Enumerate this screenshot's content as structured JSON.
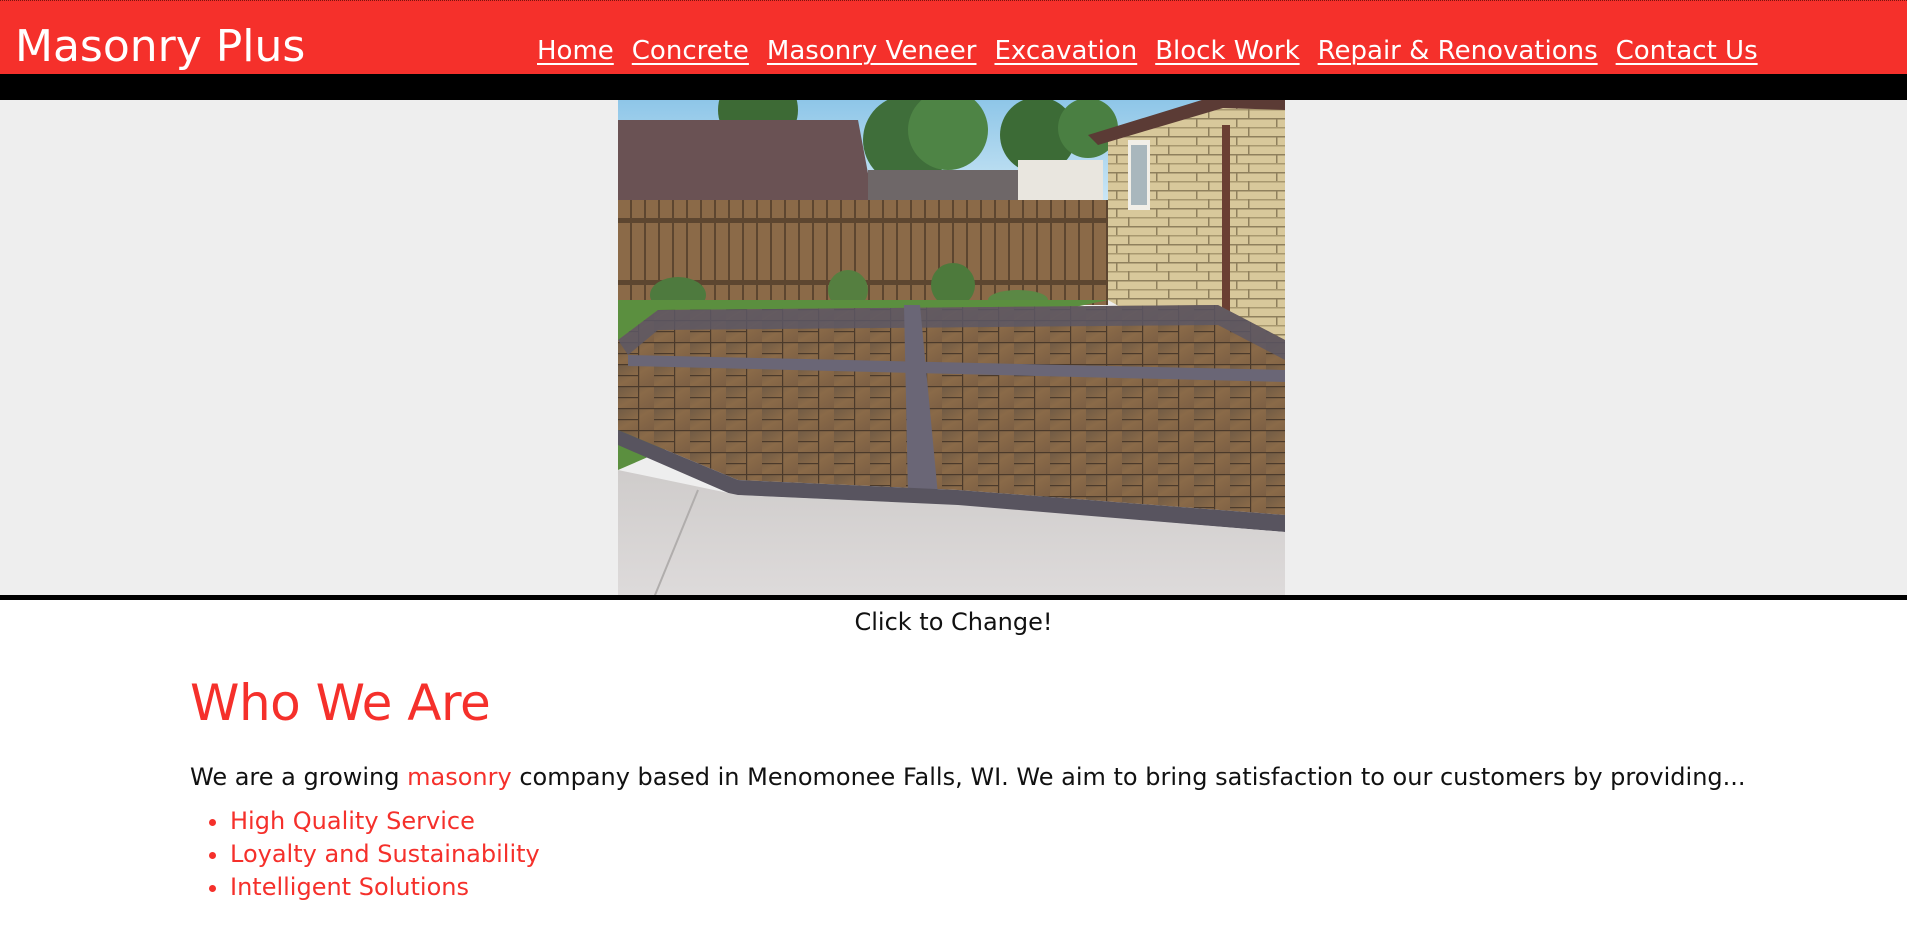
{
  "header": {
    "brand": "Masonry Plus",
    "nav": [
      {
        "label": "Home"
      },
      {
        "label": "Concrete"
      },
      {
        "label": "Masonry Veneer"
      },
      {
        "label": "Excavation"
      },
      {
        "label": "Block Work"
      },
      {
        "label": "Repair & Renovations"
      },
      {
        "label": "Contact Us"
      }
    ]
  },
  "slider": {
    "caption": "Click to Change!"
  },
  "about": {
    "heading": "Who We Are",
    "intro_before": "We are a growing ",
    "intro_highlight": "masonry",
    "intro_after": " company based in Menomonee Falls, WI. We aim to bring satisfaction to our customers by providing...",
    "points": [
      "High Quality Service",
      "Loyalty and Sustainability",
      "Intelligent Solutions"
    ]
  },
  "colors": {
    "brand_red": "#f5302b",
    "bar_black": "#000000",
    "band_gray": "#eeeeee"
  }
}
